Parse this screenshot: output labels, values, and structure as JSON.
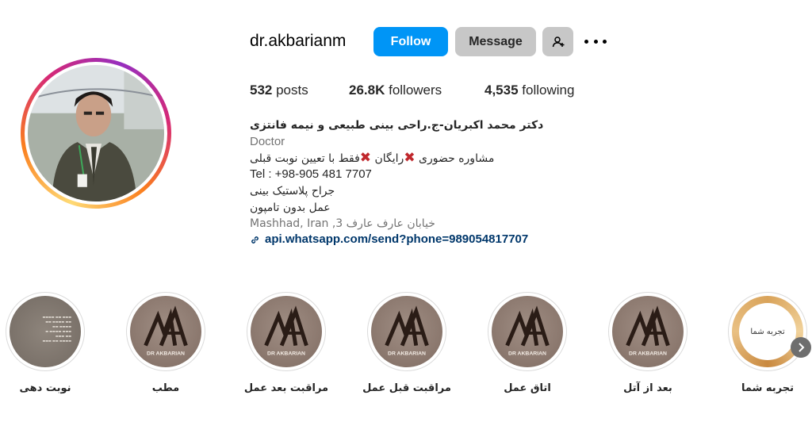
{
  "profile": {
    "username": "dr.akbarianm",
    "follow_label": "Follow",
    "message_label": "Message",
    "add_user_icon": "add-user-icon",
    "more_icon": "more-options-icon"
  },
  "stats": {
    "posts_count": "532",
    "posts_label": " posts",
    "followers_count": "26.8K",
    "followers_label": " followers",
    "following_count": "4,535",
    "following_label": " following"
  },
  "bio": {
    "name": "دکتر محمد اکبریان-ج.راحی بینی طبیعی و نیمه فانتزی",
    "category": "Doctor",
    "line1_a": "مشاوره حضوری",
    "line1_b": "رایگان",
    "line1_c": "فقط با تعیین نوبت قبلی",
    "mark": "✖",
    "tel": "Tel : +98-905 481 7707",
    "line3": "جراح پلاستیک بینی",
    "line4": "عمل بدون تامپون",
    "location": "Mashhad, Iran ,3 خیابان عارف عارف",
    "link": "api.whatsapp.com/send?phone=989054817707",
    "link_icon": "link-icon"
  },
  "highlights": [
    {
      "label": "نوبت دهی",
      "type": "doc"
    },
    {
      "label": "مطب",
      "type": "logo",
      "logo_text": "DR AKBARIAN"
    },
    {
      "label": "مراقبت بعد عمل",
      "type": "logo",
      "logo_text": "DR AKBARIAN"
    },
    {
      "label": "مراقبت قبل عمل",
      "type": "logo",
      "logo_text": "DR AKBARIAN"
    },
    {
      "label": "اتاق عمل",
      "type": "logo",
      "logo_text": "DR AKBARIAN"
    },
    {
      "label": "بعد از آتل",
      "type": "logo",
      "logo_text": "DR AKBARIAN"
    },
    {
      "label": "تجربه شما",
      "type": "experience",
      "inner_text": "تجربه شما"
    }
  ],
  "navigation": {
    "next_icon": "chevron-right-icon"
  },
  "colors": {
    "follow_bg": "#0095f6",
    "button_gray": "#c7c7c7",
    "link": "#00376b",
    "mark_red": "#c0282d"
  }
}
